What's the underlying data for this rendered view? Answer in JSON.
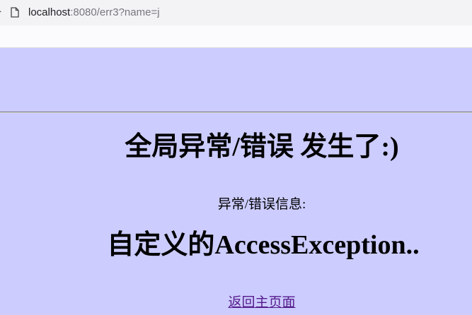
{
  "browser": {
    "url_host": "localhost",
    "url_rest": ":8080/err3?name=j"
  },
  "page": {
    "heading": "全局异常/错误 发生了:)",
    "info_label": "异常/错误信息:",
    "exception_message": "自定义的AccessException..",
    "home_link": "返回主页面"
  },
  "colors": {
    "page_background": "#ccccff",
    "link": "#551a8b"
  },
  "icons": {
    "page": "page-icon"
  }
}
